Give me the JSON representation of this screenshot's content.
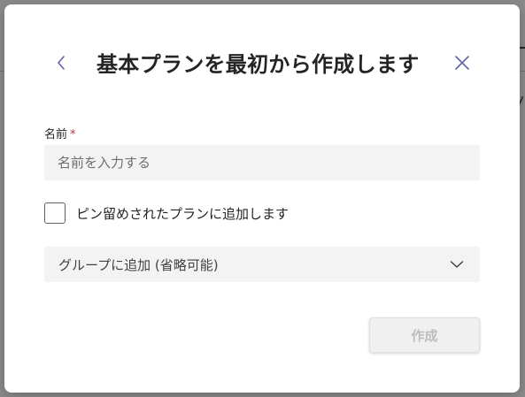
{
  "dialog": {
    "title": "基本プランを最初から作成します",
    "back_icon": "chevron-left-icon",
    "close_icon": "close-icon",
    "accent_color": "#6264a7"
  },
  "form": {
    "name_label": "名前",
    "required_mark": "*",
    "name_placeholder": "名前を入力する",
    "name_value": "",
    "pin_checked": false,
    "pin_label": "ピン留めされたプランに追加します",
    "group_placeholder": "グループに追加 (省略可能)",
    "group_icon": "chevron-down-icon",
    "create_label": "作成",
    "create_enabled": false
  }
}
